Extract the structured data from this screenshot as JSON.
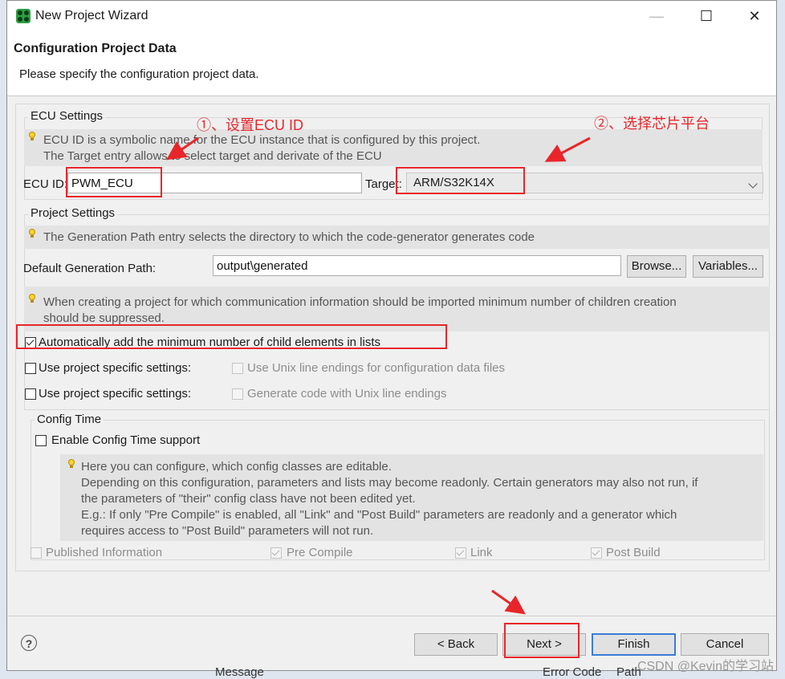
{
  "window": {
    "title": "New Project Wizard",
    "minimize_glyph": "—",
    "maximize_glyph": "☐",
    "close_glyph": "✕",
    "icon": "app-logo-icon"
  },
  "header": {
    "title": "Configuration Project Data",
    "description": "Please specify the configuration project data."
  },
  "ecu_settings": {
    "title": "ECU Settings",
    "hint_line1": "ECU ID is a symbolic name for the ECU instance that is configured by this project.",
    "hint_line2": "The Target entry allows to select target and derivate of the ECU",
    "ecu_id_label": "ECU ID:",
    "ecu_id_value": "PWM_ECU",
    "target_label": "Target:",
    "target_value": "ARM/S32K14X"
  },
  "project_settings": {
    "title": "Project Settings",
    "hint": "The Generation Path entry selects the directory to which the code-generator generates code",
    "gen_path_label": "Default Generation Path:",
    "gen_path_value": "output\\generated",
    "browse_label": "Browse...",
    "variables_label": "Variables...",
    "children_hint_line1": "When creating a project for which communication information should be imported minimum number of children creation",
    "children_hint_line2": "should be suppressed.",
    "auto_add_label": "Automatically add the minimum number of child elements in lists",
    "auto_add_checked": true,
    "use_specific_1_label": "Use project specific settings:",
    "unix_endings_label": "Use Unix line endings for configuration data files",
    "use_specific_2_label": "Use project specific settings:",
    "gen_unix_label": "Generate code with Unix line endings"
  },
  "config_time": {
    "title": "Config Time",
    "enable_label": "Enable Config Time support",
    "hint_lines": [
      "Here you can configure, which config classes are editable.",
      "Depending on this configuration, parameters and lists may become readonly. Certain generators may also not run, if",
      "the parameters of \"their\" config class have not been edited yet.",
      "E.g.: If only \"Pre Compile\" is enabled, all \"Link\" and \"Post Build\" parameters are readonly and a generator which",
      "requires access to \"Post Build\" parameters will not run."
    ],
    "published_label": "Published Information",
    "pre_compile_label": "Pre Compile",
    "link_label": "Link",
    "post_build_label": "Post Build"
  },
  "buttons": {
    "back": "< Back",
    "next": "Next >",
    "finish": "Finish",
    "cancel": "Cancel",
    "help": "?"
  },
  "annotations": {
    "step1": "①、设置ECU ID",
    "step2": "②、选择芯片平台",
    "color": "#e8262a"
  },
  "background": {
    "message_col": "Message",
    "error_code_col": "Error Code",
    "path_col": "Path"
  },
  "watermark": "CSDN @Kevin的学习站"
}
